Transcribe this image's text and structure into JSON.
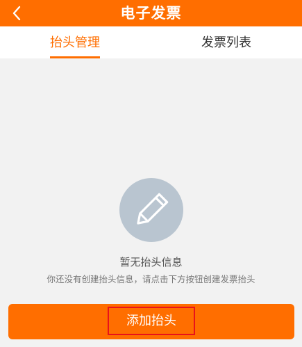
{
  "header": {
    "title": "电子发票",
    "back_icon": "chevron-left-icon",
    "background_color": "#ff6e00"
  },
  "tabs": [
    {
      "label": "抬头管理",
      "active": true
    },
    {
      "label": "发票列表",
      "active": false
    }
  ],
  "accent_color": "#ff6e00",
  "empty_state": {
    "icon": "pencil-icon",
    "title": "暂无抬头信息",
    "description": "你还没有创建抬头信息，请点击下方按钮创建发票抬头"
  },
  "footer": {
    "add_button_label": "添加抬头"
  }
}
